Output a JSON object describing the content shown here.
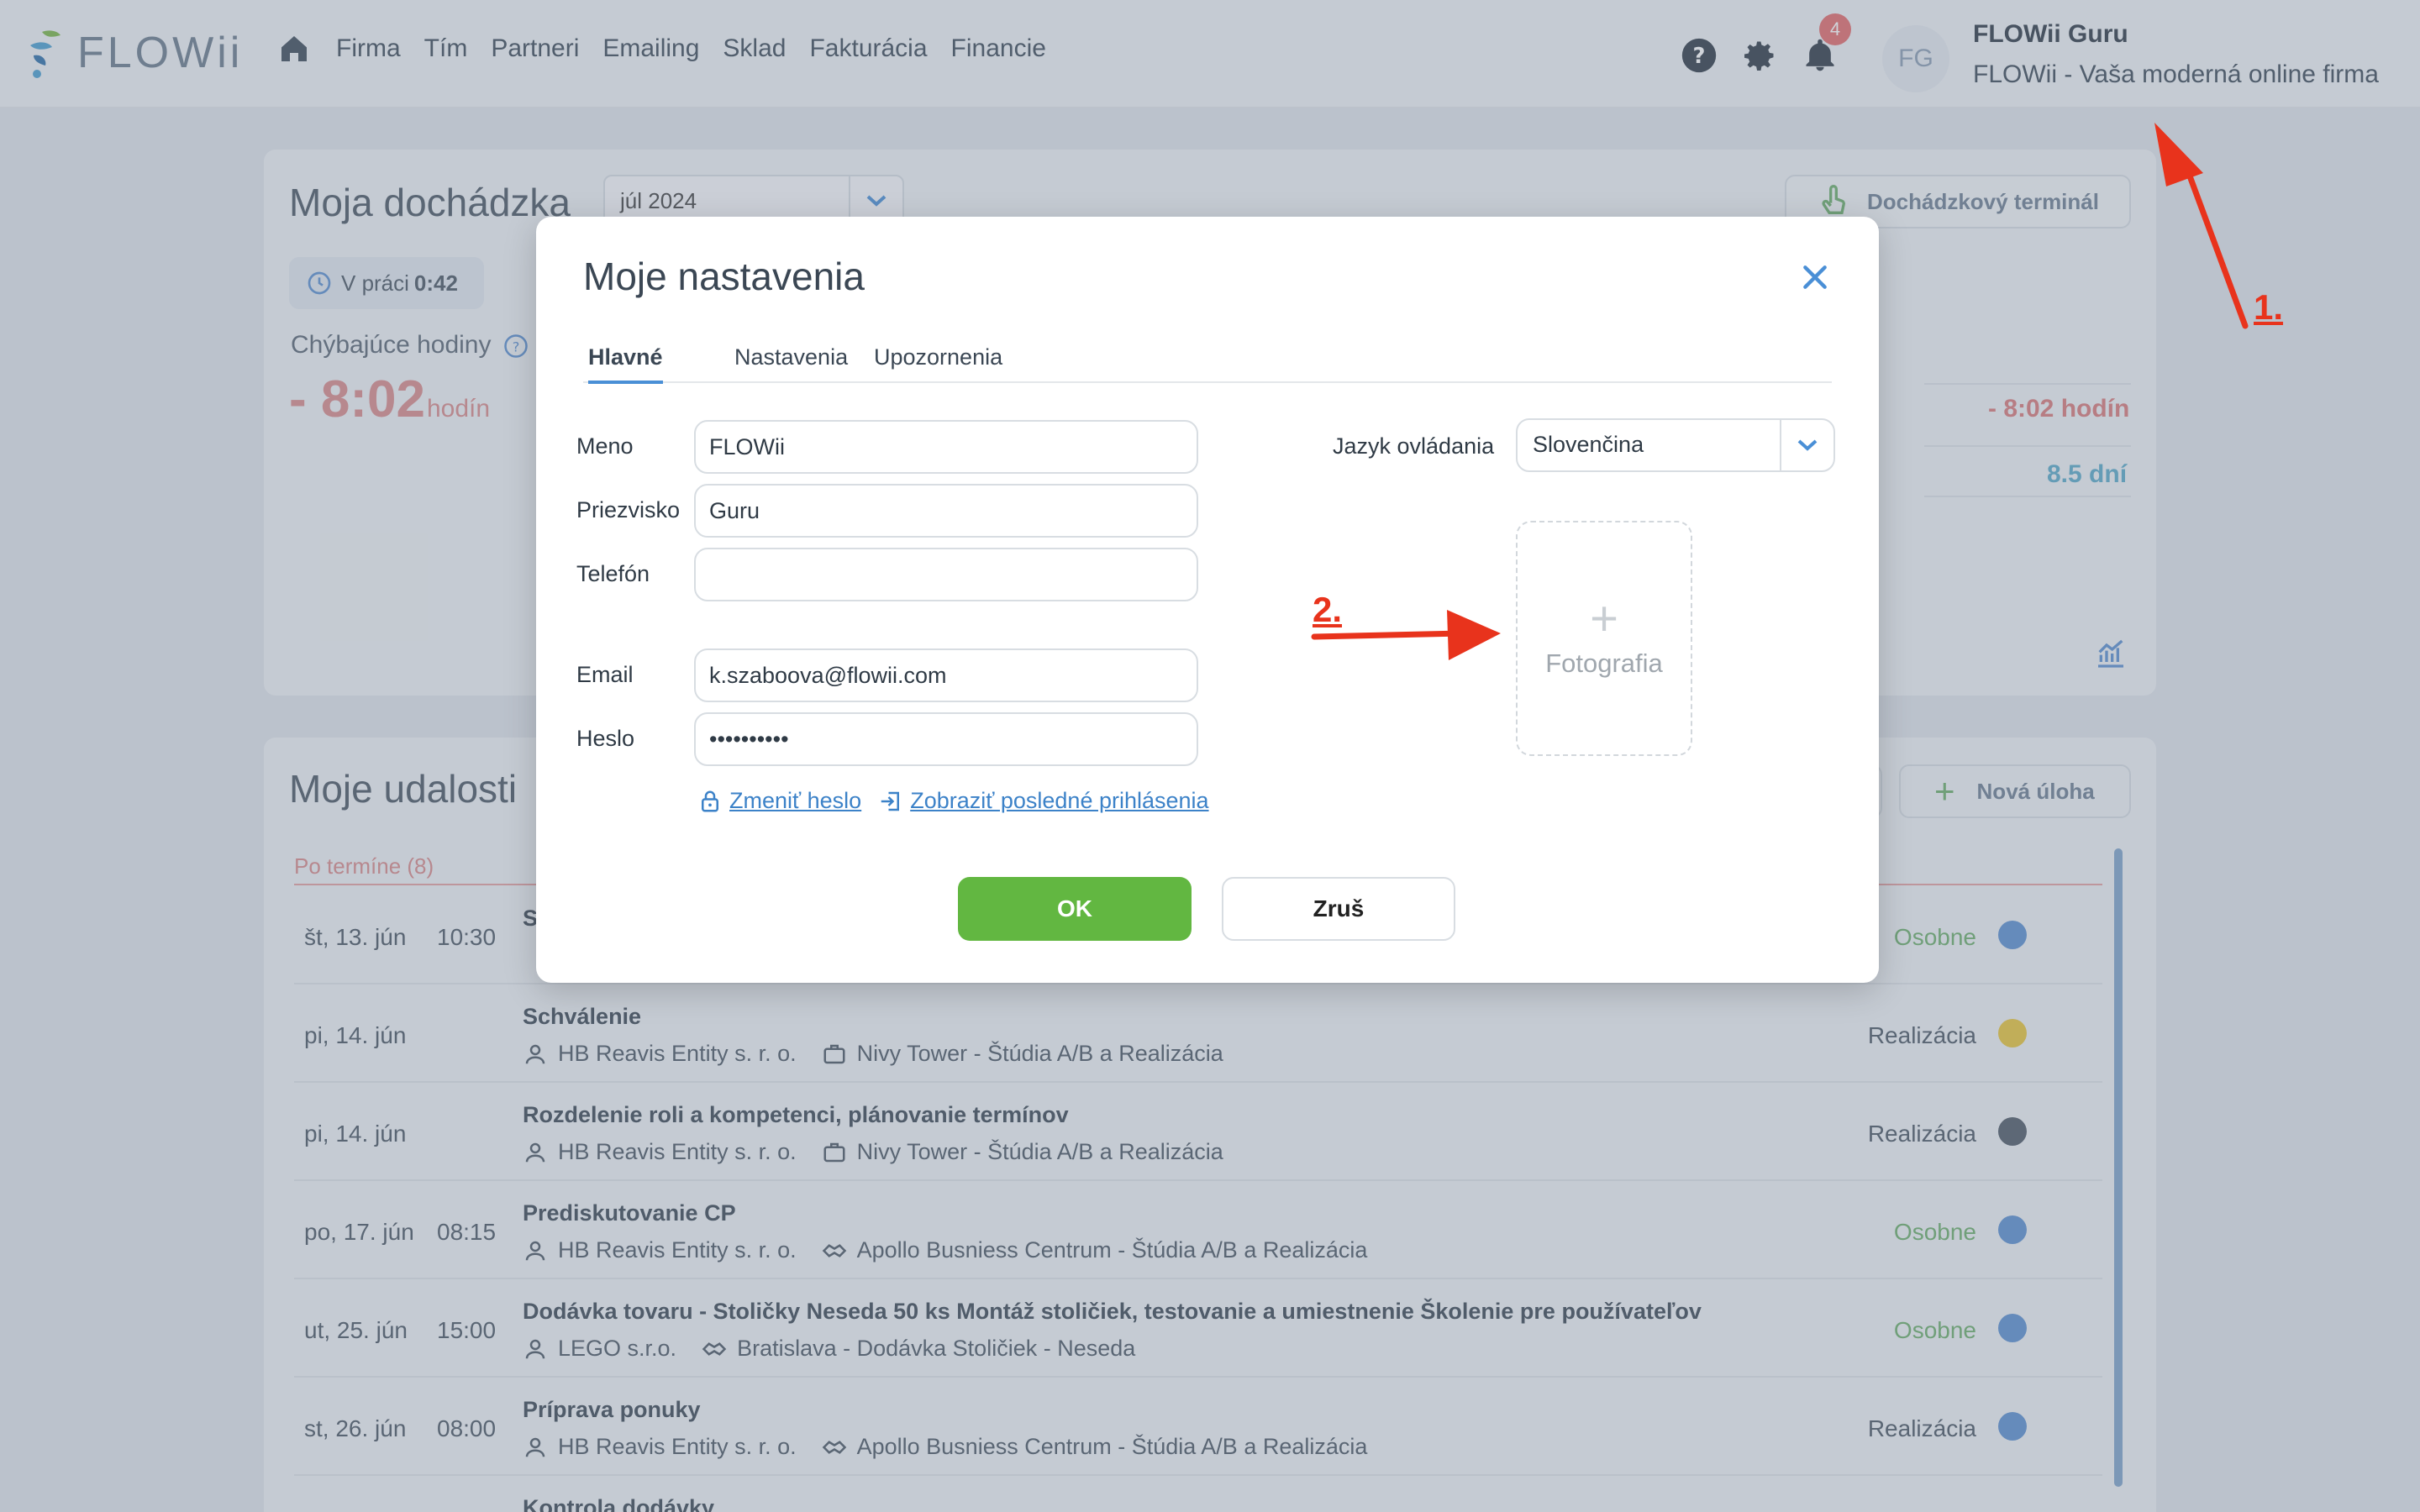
{
  "topbar": {
    "brand": "FLOWii",
    "nav": [
      "Firma",
      "Tím",
      "Partneri",
      "Emailing",
      "Sklad",
      "Fakturácia",
      "Financie"
    ],
    "notification_count": "4",
    "avatar_initials": "FG",
    "user_name": "FLOWii Guru",
    "user_subtitle": "FLOWii - Vaša moderná online firma"
  },
  "attendance": {
    "title": "Moja dochádzka",
    "month": "júl 2024",
    "terminal_button": "Dochádzkový terminál",
    "in_work_label": "V práci",
    "in_work_value": "0:42",
    "missing_label": "Chýbajúce hodiny",
    "missing_value": "- 8:02",
    "missing_unit": "hodín",
    "right_hours": "- 8:02 hodín",
    "right_days": "8.5 dní"
  },
  "events": {
    "title": "Moje udalosti",
    "new_task_button": "Nová úloha",
    "overdue_label": "Po termíne (8)",
    "rows": [
      {
        "date": "št, 13. jún",
        "time": "10:30",
        "title": "S",
        "client": "",
        "project": "",
        "category": "Osobne",
        "status_color": "#5b8fd0"
      },
      {
        "date": "pi, 14. jún",
        "time": "",
        "title": "Schválenie",
        "client": "HB Reavis Entity s. r. o.",
        "project": "Nivy Tower - Štúdia A/B a Realizácia",
        "category": "Realizácia",
        "status_color": "#e8c53a"
      },
      {
        "date": "pi, 14. jún",
        "time": "",
        "title": "Rozdelenie roli a kompetenci, plánovanie termínov",
        "client": "HB Reavis Entity s. r. o.",
        "project": "Nivy Tower - Štúdia A/B a Realizácia",
        "category": "Realizácia",
        "status_color": "#4f5a66"
      },
      {
        "date": "po, 17. jún",
        "time": "08:15",
        "title": "Prediskutovanie CP",
        "client": "HB Reavis Entity s. r. o.",
        "project": "Apollo Busniess Centrum - Štúdia A/B a Realizácia",
        "category": "Osobne",
        "status_color": "#5b8fd0"
      },
      {
        "date": "ut, 25. jún",
        "time": "15:00",
        "title": "Dodávka tovaru - Stoličky Neseda 50 ks Montáž stoličiek, testovanie a umiestnenie Školenie pre používateľov",
        "client": "LEGO s.r.o.",
        "project": "Bratislava - Dodávka Stoličiek - Neseda",
        "category": "Osobne",
        "status_color": "#5b8fd0"
      },
      {
        "date": "st, 26. jún",
        "time": "08:00",
        "title": "Príprava ponuky",
        "client": "HB Reavis Entity s. r. o.",
        "project": "Apollo Busniess Centrum - Štúdia A/B a Realizácia",
        "category": "Realizácia",
        "status_color": "#5b8fd0"
      },
      {
        "date": "",
        "time": "",
        "title": "Kontrola dodávky",
        "client": "",
        "project": "",
        "category": "",
        "status_color": "#5b8fd0"
      }
    ]
  },
  "modal": {
    "title": "Moje nastavenia",
    "tabs": [
      "Hlavné",
      "Nastavenia",
      "Upozornenia"
    ],
    "labels": {
      "name": "Meno",
      "surname": "Priezvisko",
      "phone": "Telefón",
      "email": "Email",
      "password": "Heslo",
      "language": "Jazyk ovládania"
    },
    "values": {
      "name": "FLOWii",
      "surname": "Guru",
      "phone": "",
      "email": "k.szaboova@flowii.com",
      "password": "••••••••••"
    },
    "language_value": "Slovenčina",
    "change_password_link": "Zmeniť heslo",
    "last_logins_link": "Zobraziť posledné prihlásenia",
    "photo_label": "Fotografia",
    "ok_button": "OK",
    "cancel_button": "Zruš"
  },
  "annotations": {
    "label1": "1.",
    "label2": "2."
  },
  "colors": {
    "accent": "#4a8fd6",
    "ok": "#62b741",
    "annotation": "#e8331c",
    "overdue": "#d98a8a",
    "personal": "#6cae6a"
  }
}
